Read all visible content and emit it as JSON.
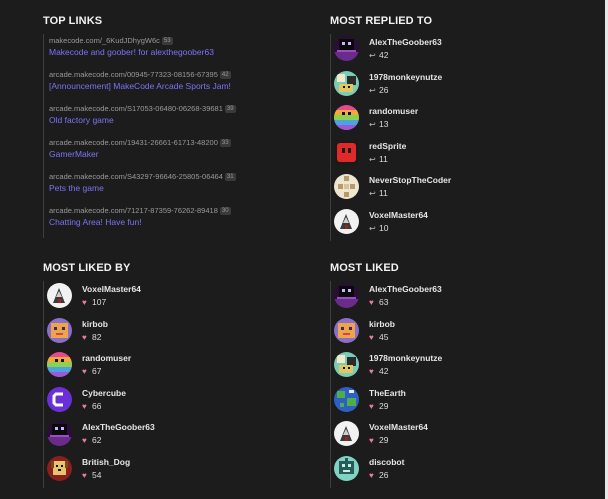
{
  "top_links": {
    "title": "TOP LINKS",
    "items": [
      {
        "url": "makecode.com/_6KudJDhygW6c",
        "count": "53",
        "title": "Makecode and goober! for alexthegoober63"
      },
      {
        "url": "arcade.makecode.com/00945-77323-08156-67395",
        "count": "42",
        "title": "[Announcement] MakeCode Arcade Sports Jam!"
      },
      {
        "url": "arcade.makecode.com/S17053-06480-06268-39681",
        "count": "39",
        "title": "Old factory game"
      },
      {
        "url": "arcade.makecode.com/19431-26661-61713-48200",
        "count": "33",
        "title": "GamerMaker"
      },
      {
        "url": "arcade.makecode.com/S43297-96646-25805-06464",
        "count": "31",
        "title": "Pets the game"
      },
      {
        "url": "arcade.makecode.com/71217-87359-76262-89418",
        "count": "30",
        "title": "Chatting Area! Have fun!"
      }
    ]
  },
  "most_replied": {
    "title": "MOST REPLIED TO",
    "icon": "reply-icon",
    "items": [
      {
        "name": "AlexTheGoober63",
        "count": "42",
        "avatar": "goober-avatar"
      },
      {
        "name": "1978monkeynutze",
        "count": "26",
        "avatar": "monkey-avatar"
      },
      {
        "name": "randomuser",
        "count": "13",
        "avatar": "rainbow-avatar"
      },
      {
        "name": "redSprite",
        "count": "11",
        "avatar": "redsprite-avatar"
      },
      {
        "name": "NeverStopTheCoder",
        "count": "11",
        "avatar": "tan-pattern-avatar"
      },
      {
        "name": "VoxelMaster64",
        "count": "10",
        "avatar": "voxel-avatar"
      }
    ]
  },
  "most_liked_by": {
    "title": "MOST LIKED BY",
    "icon": "heart-icon",
    "items": [
      {
        "name": "VoxelMaster64",
        "count": "107",
        "avatar": "voxel-avatar"
      },
      {
        "name": "kirbob",
        "count": "82",
        "avatar": "kirbob-avatar"
      },
      {
        "name": "randomuser",
        "count": "67",
        "avatar": "rainbow-avatar"
      },
      {
        "name": "Cybercube",
        "count": "66",
        "avatar": "cybercube-avatar"
      },
      {
        "name": "AlexTheGoober63",
        "count": "62",
        "avatar": "goober-avatar"
      },
      {
        "name": "British_Dog",
        "count": "54",
        "avatar": "dog-avatar"
      }
    ]
  },
  "most_liked": {
    "title": "MOST LIKED",
    "icon": "heart-icon",
    "items": [
      {
        "name": "AlexTheGoober63",
        "count": "63",
        "avatar": "goober-avatar"
      },
      {
        "name": "kirbob",
        "count": "45",
        "avatar": "kirbob-avatar"
      },
      {
        "name": "1978monkeynutze",
        "count": "42",
        "avatar": "monkey-avatar"
      },
      {
        "name": "TheEarth",
        "count": "29",
        "avatar": "earth-avatar"
      },
      {
        "name": "VoxelMaster64",
        "count": "29",
        "avatar": "voxel-avatar"
      },
      {
        "name": "discobot",
        "count": "26",
        "avatar": "discobot-avatar"
      }
    ]
  },
  "colors": {
    "background": "#1c1c1c",
    "link": "#7b74f5",
    "heart": "#e97e9c"
  }
}
